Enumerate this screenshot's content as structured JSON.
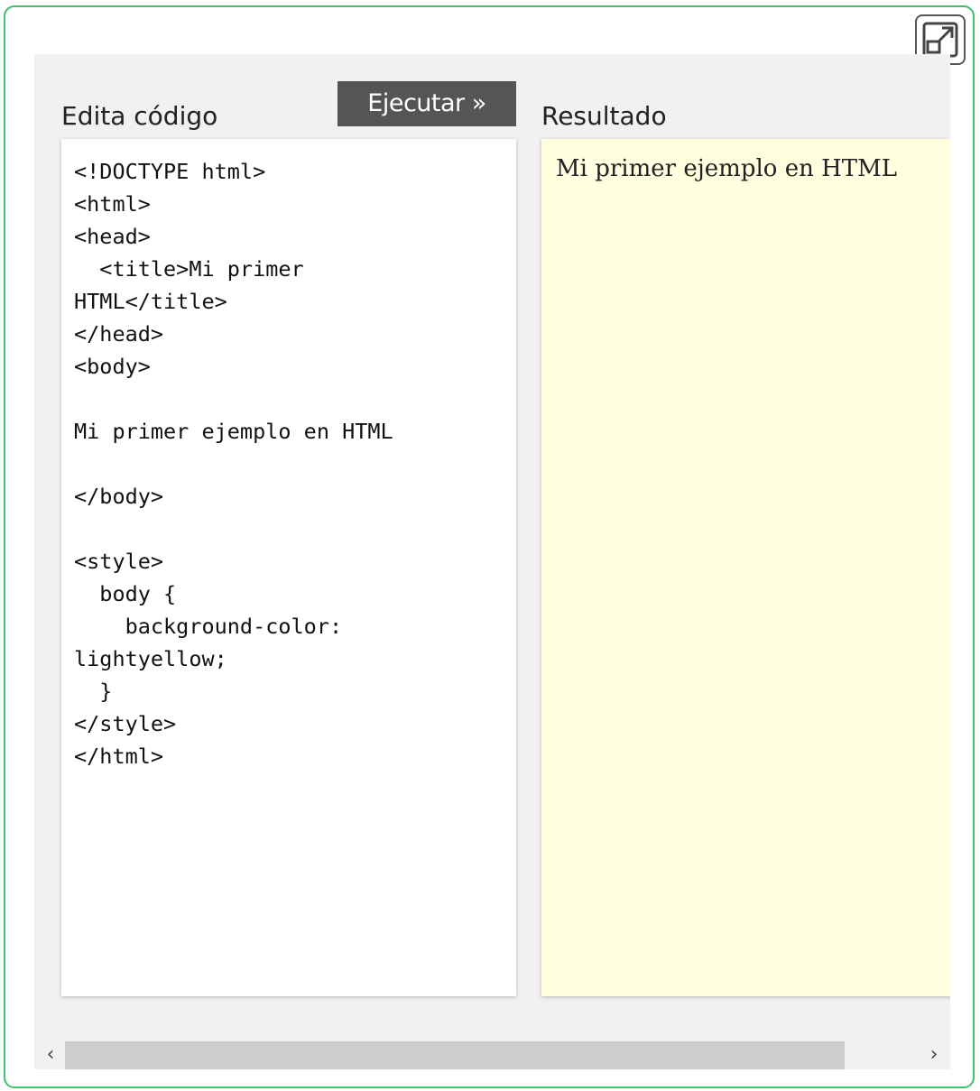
{
  "editor": {
    "code_label": "Edita código",
    "run_label": "Ejecutar »",
    "result_label": "Resultado",
    "code": "<!DOCTYPE html>\n<html>\n<head>\n  <title>Mi primer\nHTML</title>\n</head>\n<body>\n\nMi primer ejemplo en HTML\n\n</body>\n\n<style>\n  body {\n    background-color:\nlightyellow;\n  }\n</style>\n</html>",
    "result_text": "Mi primer ejemplo en HTML"
  },
  "scrollbar": {
    "left_arrow": "‹",
    "right_arrow": "›"
  },
  "colors": {
    "frame_border": "#3fbf6f",
    "run_button": "#555555",
    "result_background": "#ffffe0",
    "editor_background": "#f1f1f1"
  },
  "icons": {
    "fullscreen": "expand-fullscreen-icon"
  }
}
